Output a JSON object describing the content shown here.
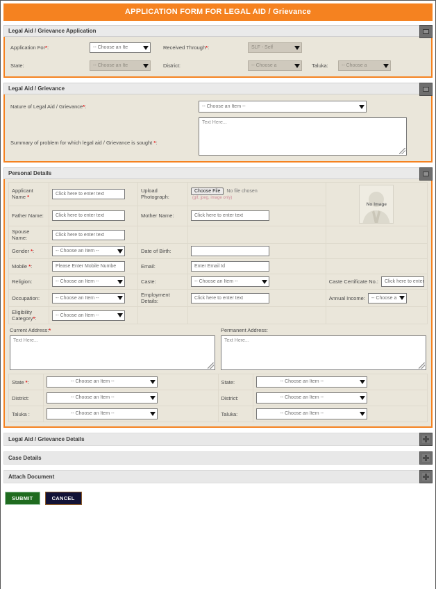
{
  "page": {
    "title": "APPLICATION FORM FOR LEGAL AID / Grievance",
    "accent_color": "#f58220",
    "body_bg": "#eae6da"
  },
  "sections": {
    "application": {
      "header": "Legal Aid / Grievance Application",
      "toggle_icon": "minus-icon",
      "fields": {
        "application_for_label": "Application For",
        "application_for_value": "-- Choose an Ite",
        "received_through_label": "Received Through",
        "received_through_value": "SLF - Self",
        "state_label": "State:",
        "state_value": "-- Choose an Ite",
        "district_label": "District:",
        "district_value": "-- Choose a",
        "taluka_label": "Taluka:",
        "taluka_value": "-- Choose a"
      }
    },
    "grievance": {
      "header": "Legal Aid / Grievance",
      "toggle_icon": "minus-icon",
      "fields": {
        "nature_label": "Nature of Legal Aid / Grievance",
        "nature_value": "-- Choose an Item --",
        "summary_label": "Summary of problem for which legal aid / Grievance is sought",
        "summary_placeholder": "Text Here..."
      }
    },
    "personal": {
      "header": "Personal Details",
      "toggle_icon": "minus-icon",
      "rows": [
        {
          "left_label": "Applicant Name",
          "left_required": true,
          "left_type": "text",
          "left_value": "Click here to enter text",
          "right_label": "Upload Photograph:",
          "right_type": "file",
          "file_button": "Choose File",
          "file_status": "No file chosen",
          "file_hint": "(gif, jpeg, image only)"
        },
        {
          "left_label": "Father Name:",
          "left_required": false,
          "left_type": "text",
          "left_value": "Click here to enter text",
          "right_label": "Mother Name:",
          "right_type": "text",
          "right_value": "Click here to enter text"
        },
        {
          "left_label": "Spouse Name:",
          "left_required": false,
          "left_type": "text",
          "left_value": "Click here to enter text",
          "right_label": "",
          "right_type": "none"
        },
        {
          "left_label": "Gender",
          "left_required": true,
          "left_type": "select",
          "left_value": "-- Choose an Item --",
          "right_label": "Date of Birth:",
          "right_type": "text",
          "right_value": ""
        },
        {
          "left_label": "Mobile",
          "left_required": true,
          "left_type": "text",
          "left_value": "Please Enter Mobile Numbe",
          "right_label": "Email:",
          "right_type": "text",
          "right_value": "Enter Email Id"
        },
        {
          "left_label": "Religion:",
          "left_required": false,
          "left_type": "select",
          "left_value": "-- Choose an Item --",
          "right_label": "Caste:",
          "right_type": "select",
          "right_value": "-- Choose an Item --",
          "extra_label": "Caste Certificate No.:",
          "extra_type": "text",
          "extra_value": "Click here to enter"
        },
        {
          "left_label": "Occupation:",
          "left_required": false,
          "left_type": "select",
          "left_value": "-- Choose an Item --",
          "right_label": "Employment Details:",
          "right_type": "text",
          "right_value": "Click here to enter text",
          "extra_label": "Annual Income:",
          "extra_type": "select",
          "extra_value": "-- Choose a"
        },
        {
          "left_label": "Eligibility Category",
          "left_required": true,
          "left_type": "select",
          "left_value": "-- Choose an Item --",
          "right_label": "",
          "right_type": "none"
        }
      ],
      "address": {
        "current_label": "Current Address:",
        "current_required": true,
        "current_placeholder": "Text Here...",
        "permanent_label": "Permanent Address:",
        "permanent_required": false,
        "permanent_placeholder": "Text Here..."
      },
      "location": {
        "left": [
          {
            "label": "State",
            "required": true,
            "value": "-- Choose an Item --"
          },
          {
            "label": "District:",
            "required": false,
            "value": "-- Choose an Item --"
          },
          {
            "label": "Taluka :",
            "required": false,
            "value": "-- Choose an Item --"
          }
        ],
        "right": [
          {
            "label": "State:",
            "required": false,
            "value": "-- Choose an Item --"
          },
          {
            "label": "District:",
            "required": false,
            "value": "-- Choose an Item --"
          },
          {
            "label": "Taluka:",
            "required": false,
            "value": "-- Choose an Item --"
          }
        ]
      }
    }
  },
  "collapsed_sections": [
    {
      "header": "Legal Aid / Grievance Details",
      "toggle_icon": "plus-icon"
    },
    {
      "header": "Case Details",
      "toggle_icon": "plus-icon"
    },
    {
      "header": "Attach Document",
      "toggle_icon": "plus-icon"
    }
  ],
  "actions": {
    "submit_label": "SUBMIT",
    "cancel_label": "CANCEL",
    "submit_color": "#1f6b1f",
    "cancel_color": "#121236"
  },
  "photo_placeholder": {
    "label": "No Image"
  }
}
